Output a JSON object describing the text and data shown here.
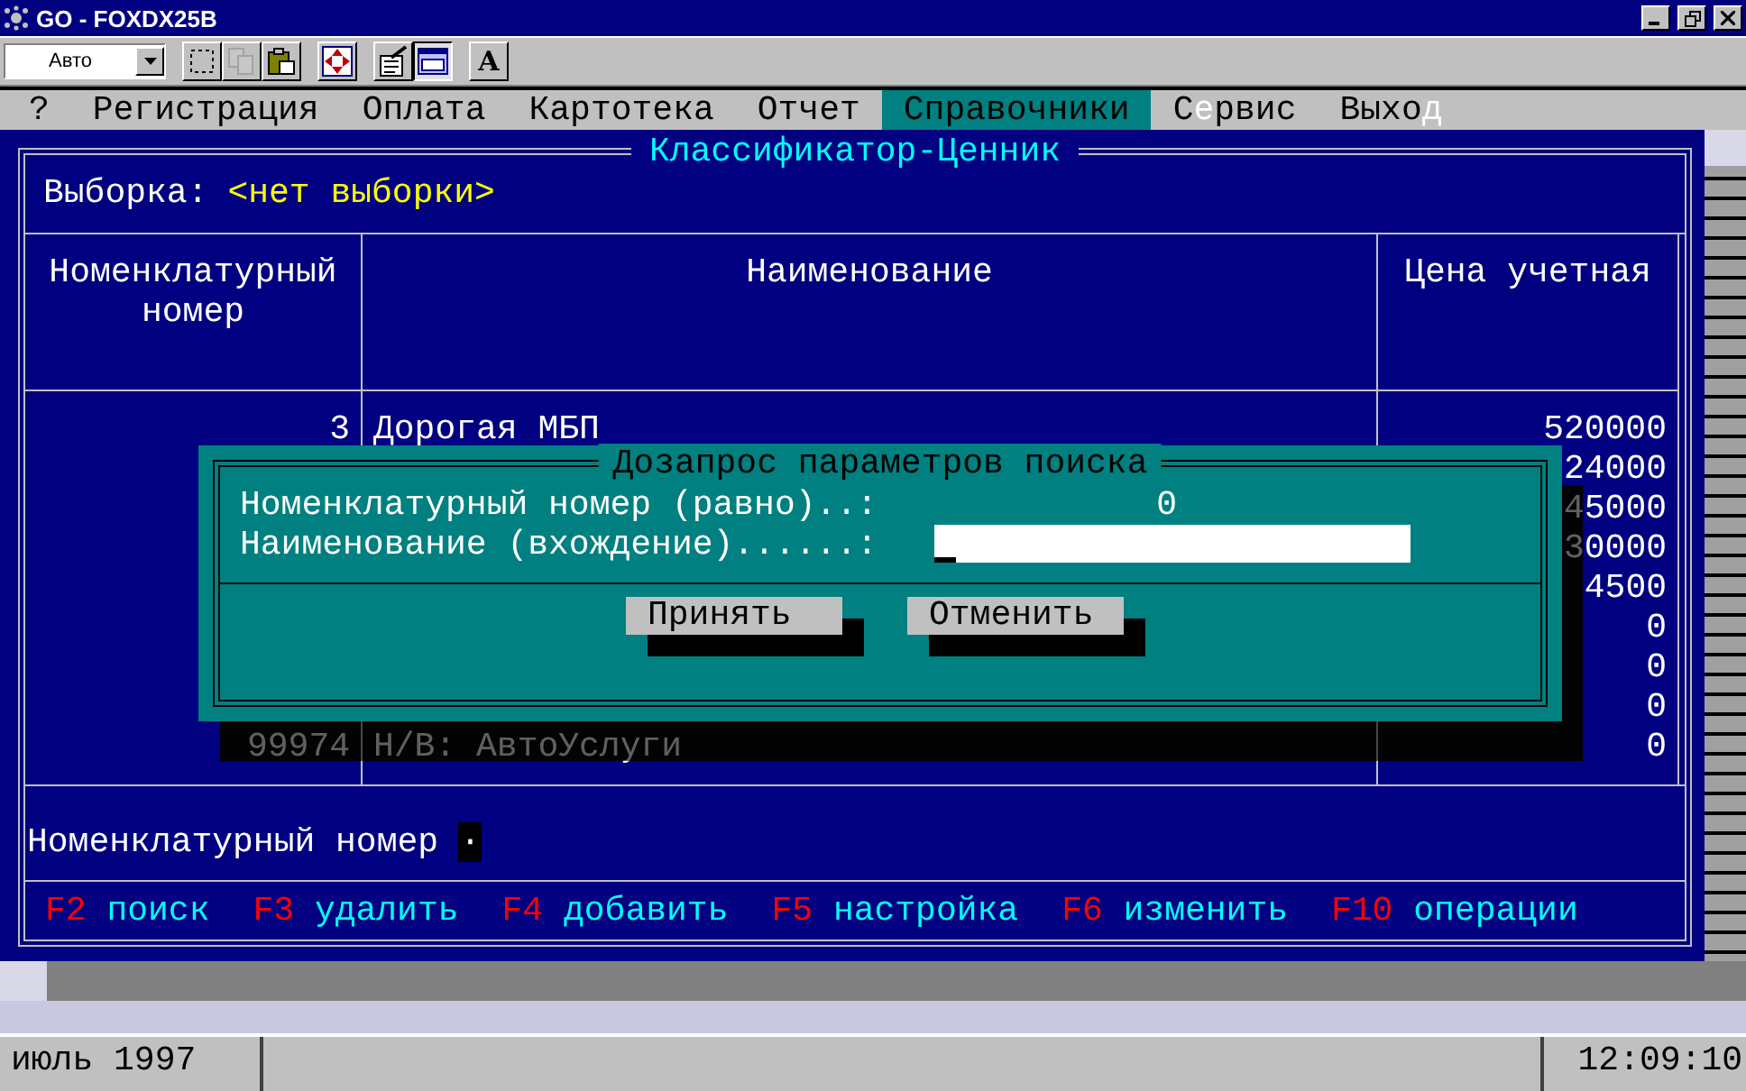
{
  "window": {
    "title": "GO - FOXDX25B"
  },
  "toolbar": {
    "mode_select": "Авто",
    "buttons": [
      {
        "kind": "select",
        "pressed": false,
        "disabled": false
      },
      {
        "kind": "copy",
        "pressed": false,
        "disabled": true
      },
      {
        "kind": "paste",
        "pressed": false,
        "disabled": false
      },
      {
        "kind": "move",
        "pressed": false,
        "disabled": false
      },
      {
        "kind": "properties",
        "pressed": false,
        "disabled": false
      },
      {
        "kind": "window",
        "pressed": true,
        "disabled": false
      },
      {
        "kind": "font",
        "label": "A",
        "pressed": false,
        "disabled": false
      }
    ]
  },
  "menu": [
    {
      "before": "?",
      "selected": false
    },
    {
      "before": "Регистрация",
      "selected": false
    },
    {
      "before": "Оплата",
      "selected": false
    },
    {
      "before": "Картотека",
      "selected": false
    },
    {
      "before": "Отчет",
      "selected": false
    },
    {
      "before": "Справочники",
      "selected": true
    },
    {
      "before": "С",
      "hotkey": "е",
      "after": "рвис",
      "selected": false
    },
    {
      "before": "Выхо",
      "hotkey": "д",
      "selected": false
    }
  ],
  "panel": {
    "title": "Классификатор-Ценник",
    "selection_label": "Выборка:",
    "selection_value": "<нет выборки>",
    "table": {
      "columns": [
        "Номенклатурный номер",
        "Наименование",
        "Цена учетная"
      ],
      "rows": [
        {
          "code": "3",
          "name": "Дорогая МБП",
          "price": "520000"
        },
        {
          "price": "24000"
        },
        {
          "price": "45000"
        },
        {
          "price": "30000"
        },
        {
          "price": "4500"
        },
        {
          "price": "0"
        },
        {
          "price": "0"
        },
        {
          "price": "0"
        },
        {
          "code": "99974",
          "name": "Н/В: АвтоУслуги",
          "price": "0"
        }
      ]
    },
    "field": {
      "label": "Номенклатурный номер",
      "value": "·"
    },
    "function_keys": [
      {
        "key": "F2",
        "label": "поиск"
      },
      {
        "key": "F3",
        "label": "удалить"
      },
      {
        "key": "F4",
        "label": "добавить"
      },
      {
        "key": "F5",
        "label": "настройка"
      },
      {
        "key": "F6",
        "label": "изменить"
      },
      {
        "key": "F10",
        "label": "операции"
      }
    ]
  },
  "dialog": {
    "title": "Дозапрос параметров поиска",
    "fields": [
      {
        "kind": "value",
        "label": "Номенклатурный номер (равно)..:",
        "value": "0"
      },
      {
        "kind": "input",
        "label": "Наименование (вхождение)......:"
      }
    ],
    "buttons": [
      "Принять",
      "Отменить"
    ]
  },
  "status_bar": {
    "date": "июль 1997",
    "time": "12:09:10"
  }
}
